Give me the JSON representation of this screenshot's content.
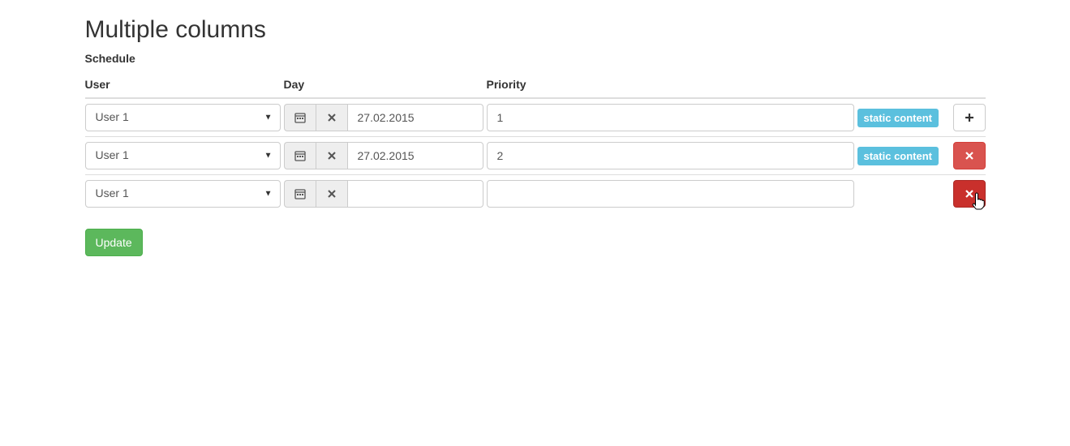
{
  "page": {
    "title": "Multiple columns",
    "section_label": "Schedule"
  },
  "headers": {
    "user": "User",
    "day": "Day",
    "priority": "Priority"
  },
  "rows": [
    {
      "user": "User 1",
      "day": "27.02.2015",
      "priority": "1",
      "static": "static content",
      "action": "add"
    },
    {
      "user": "User 1",
      "day": "27.02.2015",
      "priority": "2",
      "static": "static content",
      "action": "remove"
    },
    {
      "user": "User 1",
      "day": "",
      "priority": "",
      "static": "",
      "action": "remove-hover"
    }
  ],
  "buttons": {
    "update": "Update"
  }
}
